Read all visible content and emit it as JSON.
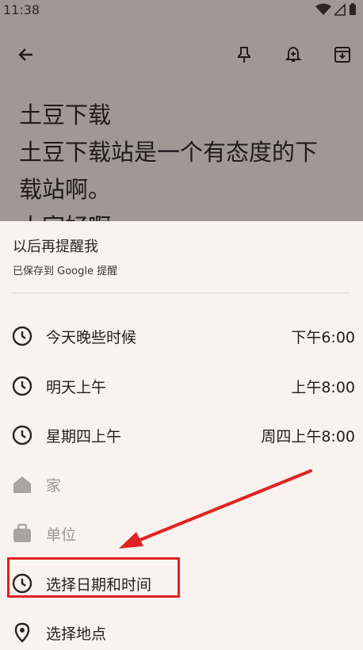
{
  "status_bar": {
    "time": "11:38"
  },
  "note": {
    "lines": [
      "土豆下载",
      "土豆下载站是一个有态度的下",
      "载站啊。",
      "大家好啊"
    ]
  },
  "sheet": {
    "title": "以后再提醒我",
    "subtitle": "已保存到 Google 提醒",
    "options": [
      {
        "label": "今天晚些时候",
        "time": "下午6:00"
      },
      {
        "label": "明天上午",
        "time": "上午8:00"
      },
      {
        "label": "星期四上午",
        "time": "周四上午8:00"
      },
      {
        "label": "家",
        "time": ""
      },
      {
        "label": "单位",
        "time": ""
      },
      {
        "label": "选择日期和时间",
        "time": ""
      },
      {
        "label": "选择地点",
        "time": ""
      }
    ]
  },
  "colors": {
    "highlight": "#e02222",
    "sheet_bg": "#faf2ee",
    "scrim": "#a19893"
  }
}
